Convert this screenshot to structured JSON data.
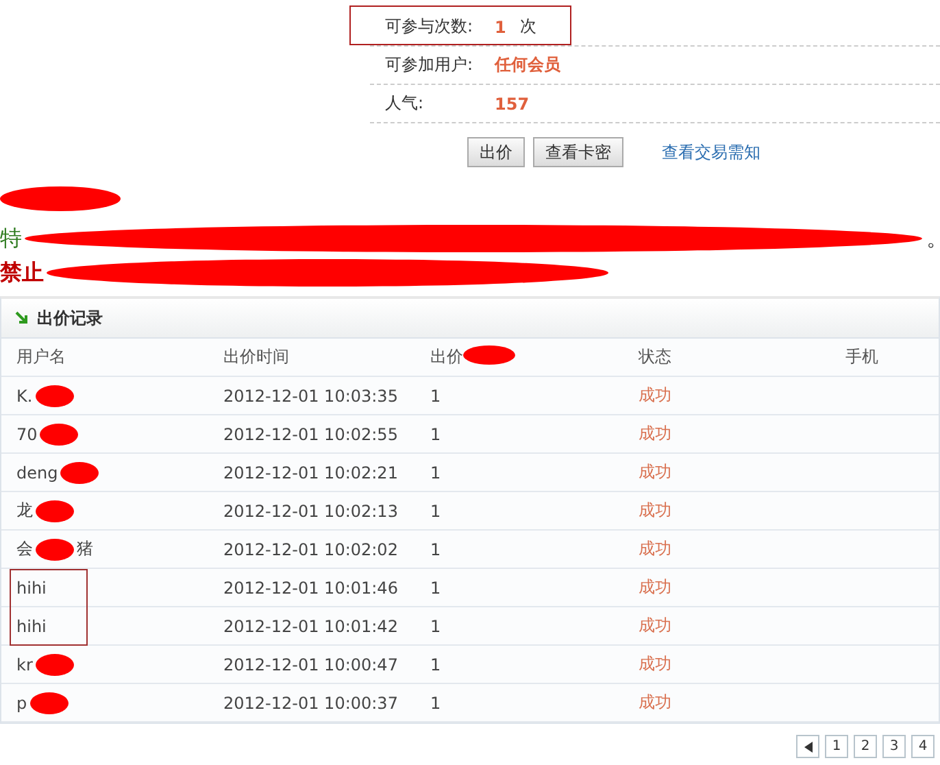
{
  "info_rows": [
    {
      "label": "可参与次数:",
      "value": "1",
      "unit": "次",
      "highlighted": true
    },
    {
      "label": "可参加用户:",
      "value": "任何会员",
      "highlighted": false
    },
    {
      "label": "人气:",
      "value": "157",
      "highlighted": false
    }
  ],
  "buttons": [
    "出价",
    "查看卡密"
  ],
  "link": "查看交易需知",
  "heading_redacted": true,
  "notices": [
    {
      "kind": "green",
      "lead": "特",
      "tail": "。",
      "redacted": true
    },
    {
      "kind": "red",
      "lead": "禁止",
      "redacted": true
    }
  ],
  "panel": {
    "title": "出价记录",
    "columns": [
      {
        "label": "用户名",
        "redacted": false
      },
      {
        "label": "出价时间",
        "redacted": false
      },
      {
        "label": "出价",
        "redacted": true
      },
      {
        "label": "状态",
        "redacted": false
      },
      {
        "label": "手机",
        "redacted": false
      }
    ],
    "rows": [
      {
        "user": "K.",
        "redacted": true,
        "highlighted": false,
        "time": "2012-12-01 10:03:35",
        "bid": "1",
        "status": "成功"
      },
      {
        "user": "70",
        "redacted": true,
        "highlighted": false,
        "time": "2012-12-01 10:02:55",
        "bid": "1",
        "status": "成功"
      },
      {
        "user": "deng",
        "redacted": true,
        "highlighted": false,
        "time": "2012-12-01 10:02:21",
        "bid": "1",
        "status": "成功"
      },
      {
        "user": "龙",
        "redacted": true,
        "highlighted": false,
        "time": "2012-12-01 10:02:13",
        "bid": "1",
        "status": "成功"
      },
      {
        "user": "会",
        "user_suffix": "猪",
        "redacted": true,
        "highlighted": false,
        "time": "2012-12-01 10:02:02",
        "bid": "1",
        "status": "成功"
      },
      {
        "user": "hihi",
        "redacted": false,
        "highlighted": true,
        "time": "2012-12-01 10:01:46",
        "bid": "1",
        "status": "成功"
      },
      {
        "user": "hihi",
        "redacted": false,
        "highlighted": true,
        "time": "2012-12-01 10:01:42",
        "bid": "1",
        "status": "成功"
      },
      {
        "user": "kr",
        "redacted": true,
        "highlighted": false,
        "time": "2012-12-01 10:00:47",
        "bid": "1",
        "status": "成功"
      },
      {
        "user": "p",
        "redacted": true,
        "highlighted": false,
        "time": "2012-12-01 10:00:37",
        "bid": "1",
        "status": "成功"
      }
    ]
  },
  "pagination": {
    "pages": [
      {
        "label": "1",
        "selected": false
      },
      {
        "label": "2",
        "selected": false
      },
      {
        "label": "3",
        "selected": false
      },
      {
        "label": "4",
        "selected": false
      }
    ]
  }
}
